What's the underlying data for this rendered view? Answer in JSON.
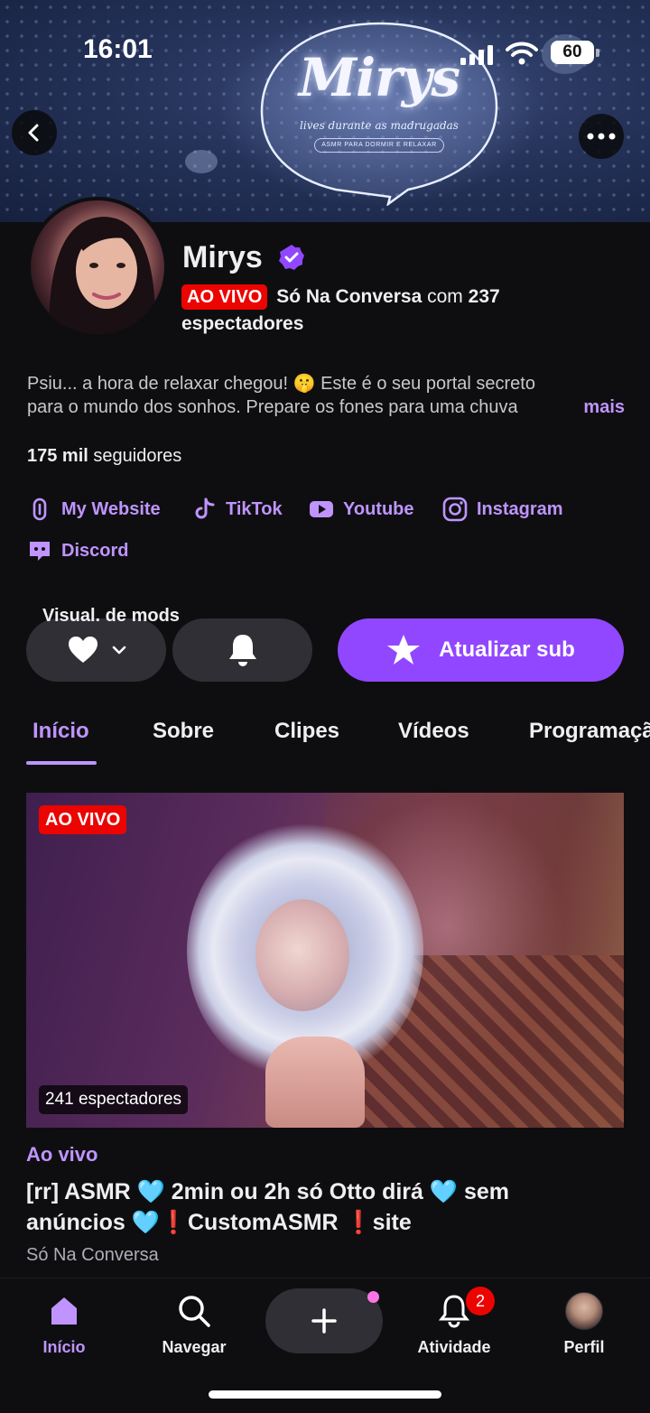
{
  "status_bar": {
    "time": "16:01",
    "battery": "60"
  },
  "banner": {
    "logo": "Mirys",
    "tagline": "lives durante as madrugadas",
    "subtitle": "ASMR PARA DORMIR E RELAXAR"
  },
  "header": {
    "back_icon": "chevron-left-icon",
    "more_icon": "more-horizontal-icon"
  },
  "profile": {
    "name": "Mirys",
    "verified_icon": "verified-badge-icon",
    "live_badge": "AO VIVO",
    "category": "Só Na Conversa",
    "with_text": "com",
    "viewer_count": "237",
    "viewers_label": "espectadores",
    "description_line1": "Psiu... a hora de relaxar chegou! 🤫 Este é o seu portal secreto",
    "description_line2": "para o mundo dos sonhos. Prepare os fones para uma chuva",
    "more_label": "mais",
    "followers_count": "175 mil",
    "followers_label": "seguidores"
  },
  "links": [
    {
      "label": "My Website",
      "icon": "link-icon"
    },
    {
      "label": "TikTok",
      "icon": "tiktok-icon"
    },
    {
      "label": "Youtube",
      "icon": "youtube-icon"
    },
    {
      "label": "Instagram",
      "icon": "instagram-icon"
    },
    {
      "label": "Discord",
      "icon": "discord-icon"
    }
  ],
  "actions": {
    "mods_label": "Visual. de mods",
    "follow_icon": "heart-icon",
    "notify_icon": "bell-icon",
    "subscribe_label": "Atualizar sub"
  },
  "tabs": [
    "Início",
    "Sobre",
    "Clipes",
    "Vídeos",
    "Programação"
  ],
  "stream": {
    "live_badge": "AO VIVO",
    "viewers": "241 espectadores",
    "section_label": "Ao vivo",
    "title_line1": "[rr] ASMR 🩵 2min ou 2h só Otto dirá 🩵 sem",
    "title_line2": "anúncios 🩵❗CustomASMR ❗site",
    "category": "Só Na Conversa"
  },
  "bottom_nav": [
    {
      "label": "Início",
      "icon": "home-icon"
    },
    {
      "label": "Navegar",
      "icon": "search-icon"
    },
    {
      "label": "",
      "icon": "plus-icon"
    },
    {
      "label": "Atividade",
      "icon": "bell-icon",
      "badge": "2"
    },
    {
      "label": "Perfil",
      "icon": "avatar"
    }
  ],
  "colors": {
    "accent": "#9147ff",
    "accent_text": "#bf94ff",
    "live": "#eb0400",
    "background": "#0e0e10"
  }
}
